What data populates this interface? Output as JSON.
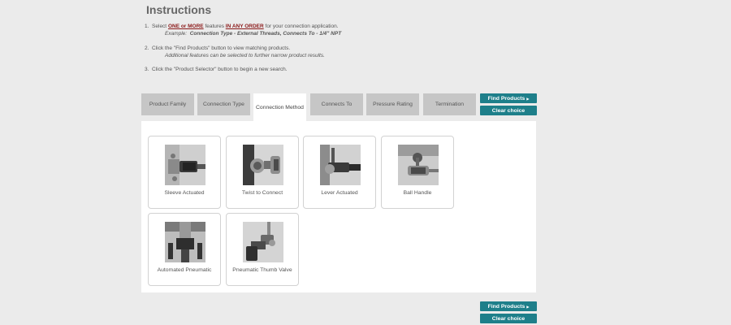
{
  "heading": "Instructions",
  "instructions": {
    "step1": {
      "num": "1.",
      "pre": "Select",
      "one_or_more": "ONE or MORE",
      "mid": "features",
      "any_order": "IN ANY ORDER",
      "post": "for your connection application.",
      "example_label": "Example:",
      "example_value": "Connection Type - External Threads, Connects To - 1/4\" NPT"
    },
    "step2": {
      "num": "2.",
      "text": "Click the \"Find Products\" button to view matching products.",
      "sub": "Additional features can be selected to further narrow product results."
    },
    "step3": {
      "num": "3.",
      "text": "Click the \"Product Selector\" button to begin a new search."
    }
  },
  "tabs": [
    {
      "label": "Product Family"
    },
    {
      "label": "Connection Type"
    },
    {
      "label": "Connection Method",
      "active": true
    },
    {
      "label": "Connects To"
    },
    {
      "label": "Pressure Rating"
    },
    {
      "label": "Termination"
    }
  ],
  "buttons": {
    "find_products": "Find Products",
    "clear_choice": "Clear choice"
  },
  "options": [
    {
      "label": "Sleeve Actuated",
      "icon": "sleeve-actuated-photo"
    },
    {
      "label": "Twist to Connect",
      "icon": "twist-to-connect-photo"
    },
    {
      "label": "Lever Actuated",
      "icon": "lever-actuated-photo"
    },
    {
      "label": "Ball Handle",
      "icon": "ball-handle-photo"
    },
    {
      "label": "Automated Pneumatic",
      "icon": "automated-pneumatic-photo"
    },
    {
      "label": "Pneumatic Thumb Valve",
      "icon": "pneumatic-thumb-valve-photo"
    }
  ],
  "colors": {
    "background": "#ebebeb",
    "accent_button": "#1e7f8a",
    "emphasis": "#8b1a1a",
    "tab_inactive": "#c6c6c6"
  }
}
